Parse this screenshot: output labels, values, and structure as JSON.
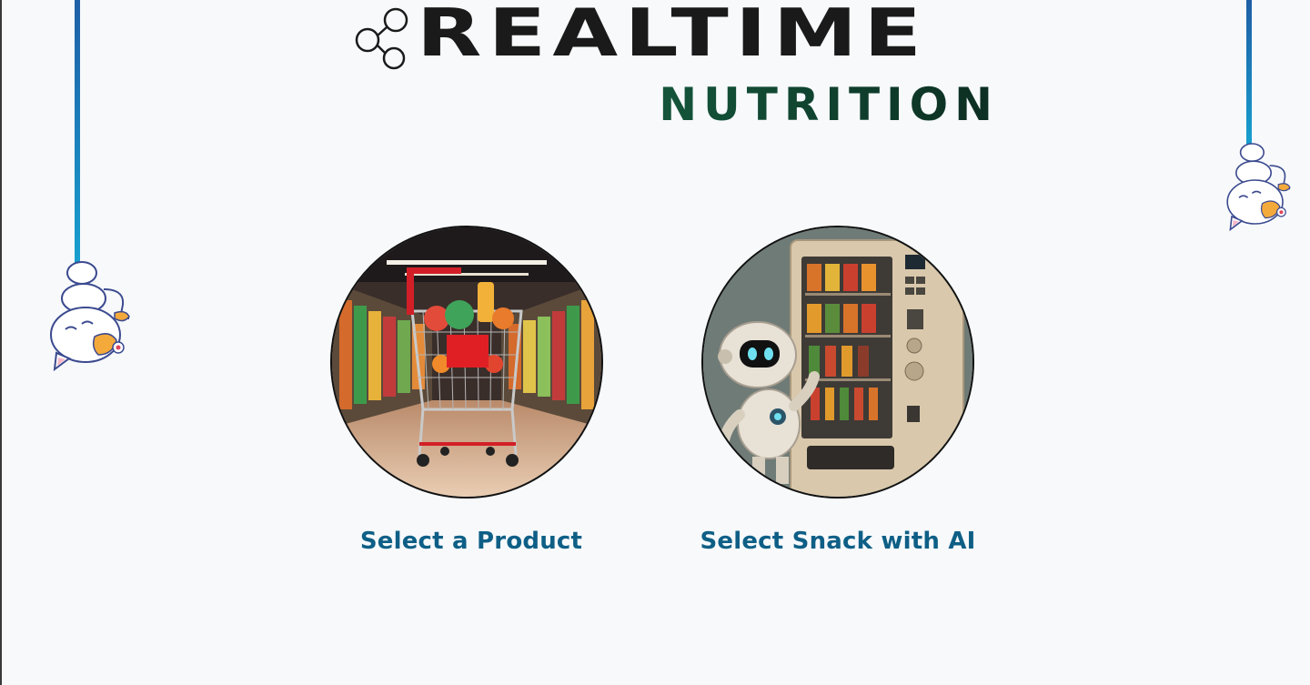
{
  "brand": {
    "title_top": "REALTIME",
    "title_bottom": "NUTRITION",
    "logo_icon": "molecule-icon"
  },
  "decorations": {
    "left_cat": "hanging-cat-icon",
    "right_cat": "hanging-cat-icon",
    "string_color": "#1a7fc0"
  },
  "options": [
    {
      "label": "Select a Product",
      "image": "shopping-cart-in-supermarket-aisle"
    },
    {
      "label": "Select Snack with AI",
      "image": "robot-at-vending-machine"
    }
  ],
  "colors": {
    "background": "#f7f9fb",
    "label": "#0e5f86",
    "nutrition": "#0f3b2a"
  }
}
